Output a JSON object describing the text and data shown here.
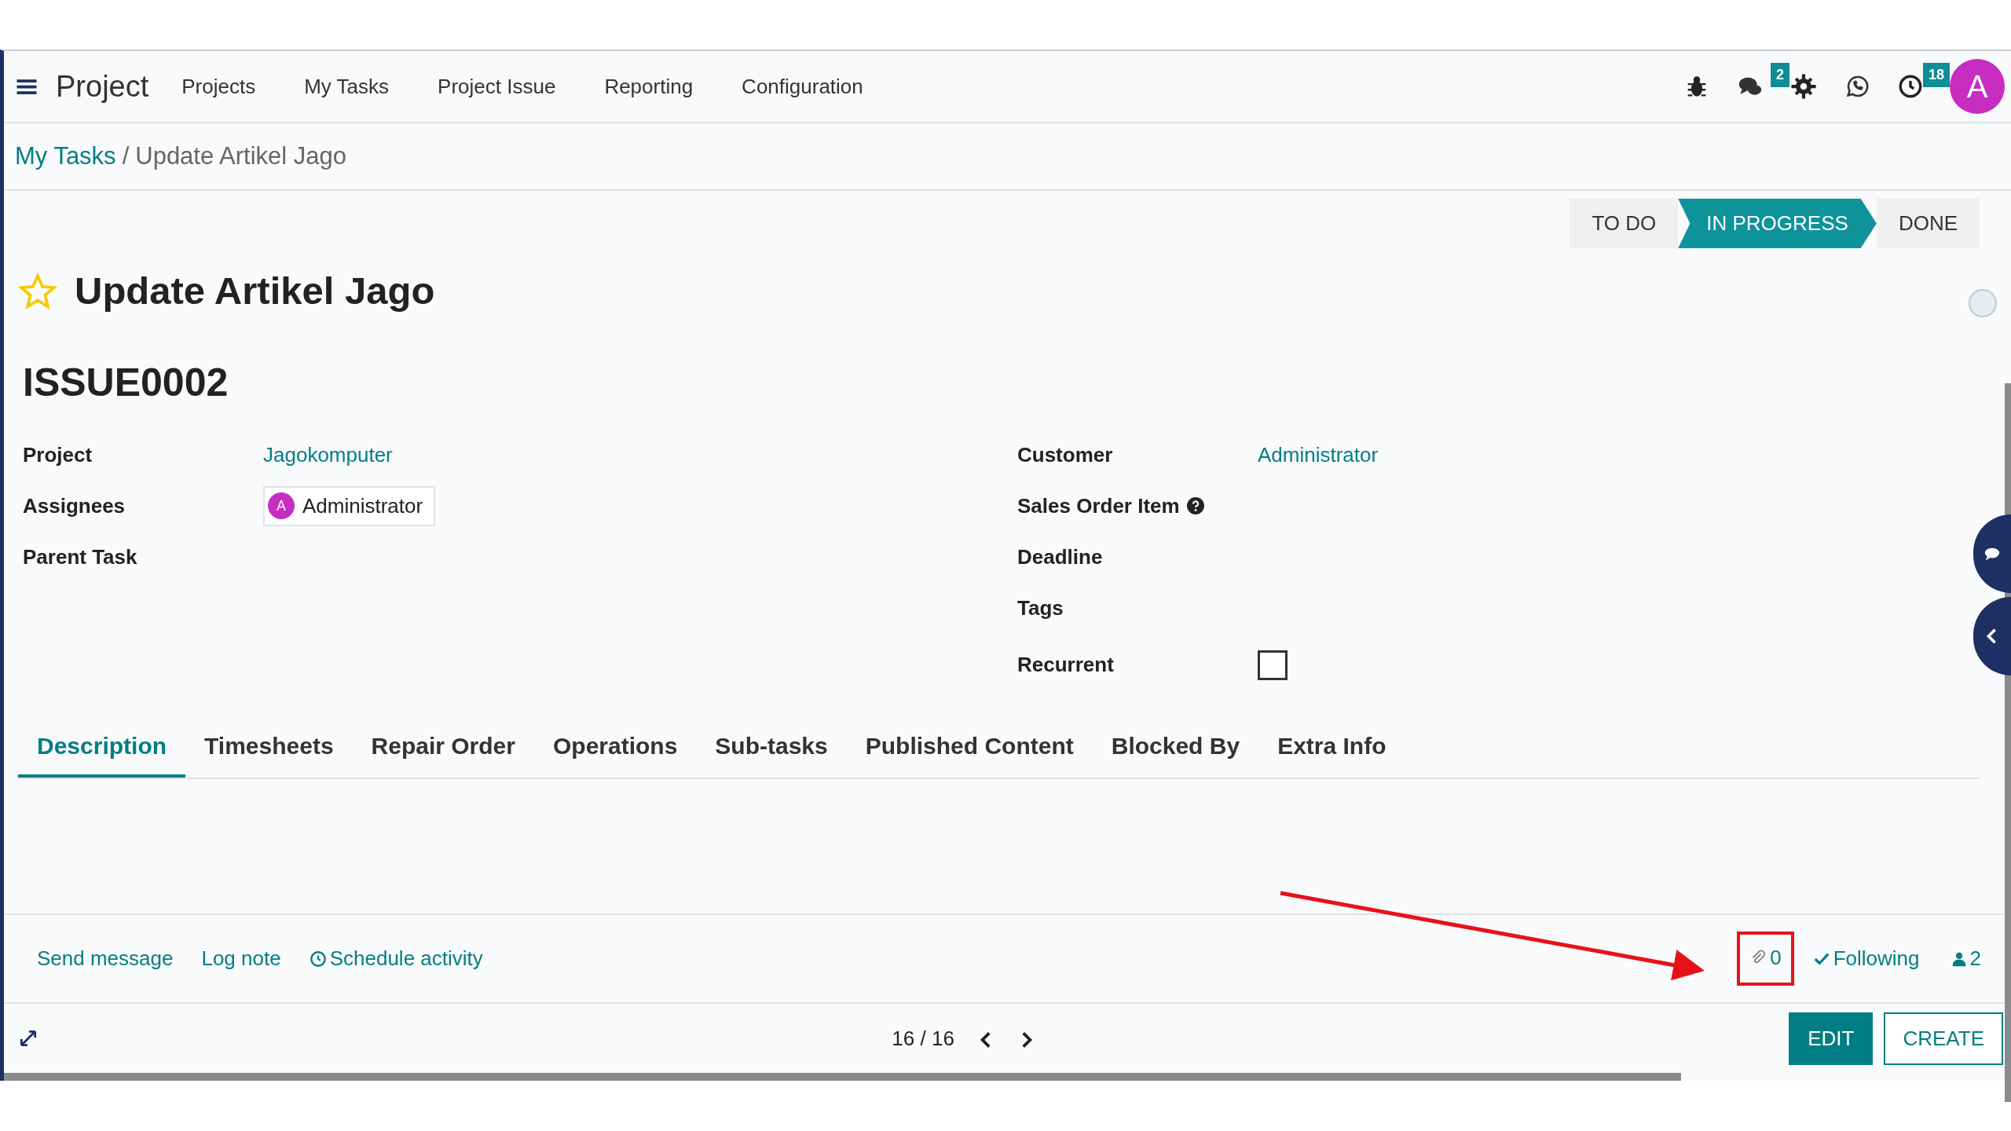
{
  "navbar": {
    "app_name": "Project",
    "menu": [
      "Projects",
      "My Tasks",
      "Project Issue",
      "Reporting",
      "Configuration"
    ],
    "icons": [
      {
        "kind": "bug"
      },
      {
        "kind": "chat",
        "badge": "2"
      },
      {
        "kind": "gear"
      },
      {
        "kind": "whatsapp"
      },
      {
        "kind": "clock",
        "badge": "18"
      }
    ],
    "avatar": "A"
  },
  "breadcrumb": {
    "parent": "My Tasks",
    "separator": "/",
    "current": "Update Artikel Jago"
  },
  "stages": [
    {
      "label": "TO DO",
      "selected": false
    },
    {
      "label": "IN PROGRESS",
      "selected": true
    },
    {
      "label": "DONE",
      "selected": false
    }
  ],
  "task": {
    "title": "Update Artikel Jago",
    "starred": false,
    "reference": "ISSUE0002"
  },
  "fields_left": [
    {
      "label": "Project",
      "kind": "link",
      "value": "Jagokomputer"
    },
    {
      "label": "Assignees",
      "kind": "tag",
      "value": "Administrator",
      "avatar": "A"
    },
    {
      "label": "Parent Task",
      "kind": "empty"
    }
  ],
  "fields_right": [
    {
      "label": "Customer",
      "kind": "link",
      "value": "Administrator"
    },
    {
      "label": "Sales Order Item",
      "kind": "help"
    },
    {
      "label": "Deadline",
      "kind": "empty"
    },
    {
      "label": "Tags",
      "kind": "empty"
    },
    {
      "label": "Recurrent",
      "kind": "checkbox",
      "checked": false
    }
  ],
  "tabs": [
    {
      "label": "Description",
      "selected": true
    },
    {
      "label": "Timesheets",
      "selected": false
    },
    {
      "label": "Repair Order",
      "selected": false
    },
    {
      "label": "Operations",
      "selected": false
    },
    {
      "label": "Sub-tasks",
      "selected": false
    },
    {
      "label": "Published Content",
      "selected": false
    },
    {
      "label": "Blocked By",
      "selected": false
    },
    {
      "label": "Extra Info",
      "selected": false
    }
  ],
  "chatter": {
    "actions": [
      {
        "label": "Send message",
        "kind": "plain"
      },
      {
        "label": "Log note",
        "kind": "plain"
      },
      {
        "label": "Schedule activity",
        "kind": "activity"
      }
    ],
    "attachments": "0",
    "following": "Following",
    "followers": "2"
  },
  "pager": "16 / 16",
  "buttons": [
    {
      "label": "EDIT",
      "kind": "primary"
    },
    {
      "label": "CREATE",
      "kind": "secondary"
    }
  ]
}
